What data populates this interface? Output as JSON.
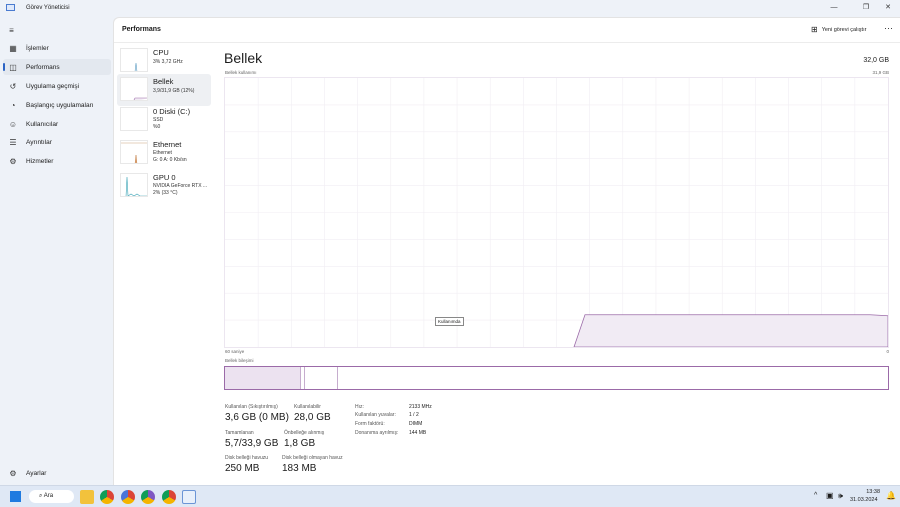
{
  "window": {
    "title": "Görev Yöneticisi"
  },
  "sidebar": {
    "items": [
      {
        "label": "İşlemler",
        "icon": "processes-icon"
      },
      {
        "label": "Performans",
        "icon": "performance-icon"
      },
      {
        "label": "Uygulama geçmişi",
        "icon": "history-icon"
      },
      {
        "label": "Başlangıç uygulamaları",
        "icon": "startup-icon"
      },
      {
        "label": "Kullanıcılar",
        "icon": "users-icon"
      },
      {
        "label": "Ayrıntılar",
        "icon": "details-icon"
      },
      {
        "label": "Hizmetler",
        "icon": "services-icon"
      }
    ],
    "settings": "Ayarlar"
  },
  "header": {
    "title": "Performans",
    "run_task": "Yeni görevi çalıştır",
    "more": "···"
  },
  "resources": [
    {
      "name": "CPU",
      "l1": "3% 3,72 GHz"
    },
    {
      "name": "Bellek",
      "l1": "3,9/31,9 GB (12%)"
    },
    {
      "name": "0 Diski (C:)",
      "l1": "SSD",
      "l2": "%0"
    },
    {
      "name": "Ethernet",
      "l1": "Ethernet",
      "l2": "G: 0 A: 0 Kb/sn"
    },
    {
      "name": "GPU 0",
      "l1": "NVIDIA GeForce RTX ...",
      "l2": "2% (33 °C)"
    }
  ],
  "memory": {
    "title": "Bellek",
    "total": "32,0 GB",
    "usage_label": "Bellek kullanımı",
    "usage_max": "31,9 GB",
    "time_left": "60 saniye",
    "time_right": "0",
    "tooltip": "Kullanımda",
    "composition_label": "Bellek bileşimi",
    "usage_fraction": 0.12,
    "composition": {
      "in_use_fraction": 0.115,
      "modified_fraction": 0.006,
      "standby_fraction": 0.05
    },
    "stats": [
      {
        "label": "Kullanılan (Sıkıştırılmış)",
        "value": "3,6 GB (0 MB)"
      },
      {
        "label": "Kullanılabilir",
        "value": "28,0 GB"
      },
      {
        "label": "Tamamlanan",
        "value": "5,7/33,9 GB"
      },
      {
        "label": "Önbelleğe alınmış",
        "value": "1,8 GB"
      },
      {
        "label": "Disk belleği havuzu",
        "value": "250 MB"
      },
      {
        "label": "Disk belleği olmayan havuz",
        "value": "183 MB"
      }
    ],
    "props": [
      {
        "k": "Hız:",
        "v": "2133 MHz"
      },
      {
        "k": "Kullanılan yuvalar:",
        "v": "1 / 2"
      },
      {
        "k": "Form faktörü:",
        "v": "DIMM"
      },
      {
        "k": "Donanıma ayrılmış:",
        "v": "144 MB"
      }
    ]
  },
  "taskbar": {
    "search": "Ara",
    "time": "13:38",
    "date": "31.03.2024"
  },
  "colors": {
    "accent": "#9b6aa8",
    "fill": "#f1ebf4"
  }
}
